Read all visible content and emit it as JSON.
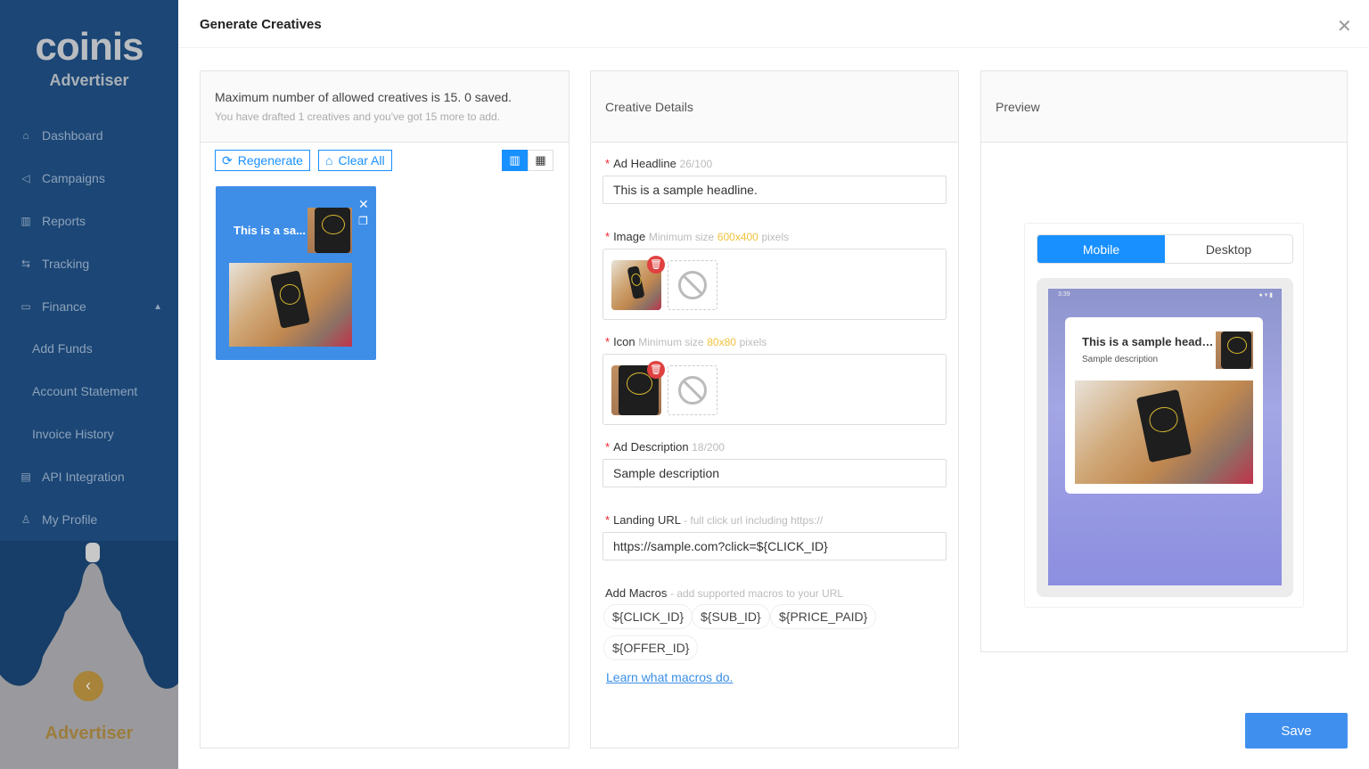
{
  "sidebar": {
    "logo": "coinis",
    "logo_subtitle": "Advertiser",
    "items": [
      {
        "label": "Dashboard",
        "icon": "home-icon"
      },
      {
        "label": "Campaigns",
        "icon": "megaphone-icon"
      },
      {
        "label": "Reports",
        "icon": "bar-chart-icon"
      },
      {
        "label": "Tracking",
        "icon": "swap-icon"
      },
      {
        "label": "Finance",
        "icon": "wallet-icon",
        "expanded": true
      },
      {
        "label": "Add Funds"
      },
      {
        "label": "Account Statement"
      },
      {
        "label": "Invoice History"
      },
      {
        "label": "API Integration",
        "icon": "api-icon"
      },
      {
        "label": "My Profile",
        "icon": "user-icon"
      }
    ],
    "footer_label": "Advertiser"
  },
  "modal": {
    "title": "Generate Creatives",
    "save_label": "Save"
  },
  "creatives_panel": {
    "info_main": "Maximum number of allowed creatives is 15. 0 saved.",
    "info_sub": "You have drafted 1 creatives and you've got 15 more to add.",
    "regenerate_label": "Regenerate",
    "clear_all_label": "Clear All",
    "view_mode": "list",
    "cards": [
      {
        "headline": "This is a sa..."
      }
    ]
  },
  "details_panel": {
    "title": "Creative Details",
    "headline": {
      "label": "Ad Headline",
      "counter": "26/100",
      "value": "This is a sample headline."
    },
    "image": {
      "label": "Image",
      "hint_pre": "Minimum size",
      "size": "600x400",
      "hint_post": "pixels"
    },
    "icon": {
      "label": "Icon",
      "hint_pre": "Minimum size",
      "size": "80x80",
      "hint_post": "pixels"
    },
    "description": {
      "label": "Ad Description",
      "counter": "18/200",
      "value": "Sample description"
    },
    "landing_url": {
      "label": "Landing URL",
      "hint": "- full click url including https://",
      "value": "https://sample.com?click=${CLICK_ID}"
    },
    "macros": {
      "label": "Add Macros",
      "hint": "- add supported macros to your URL",
      "items": [
        "${CLICK_ID}",
        "${SUB_ID}",
        "${PRICE_PAID}",
        "${OFFER_ID}"
      ],
      "learn_link": "Learn what macros do."
    }
  },
  "preview_panel": {
    "title": "Preview",
    "tabs": [
      "Mobile",
      "Desktop"
    ],
    "active_tab": "Mobile",
    "status_time": "3:39",
    "ad_headline": "This is a sample headline.",
    "ad_description": "Sample description"
  },
  "colors": {
    "accent": "#1890ff",
    "sidebar": "#1b4675",
    "required": "#f5222d",
    "delete": "#e04040"
  }
}
